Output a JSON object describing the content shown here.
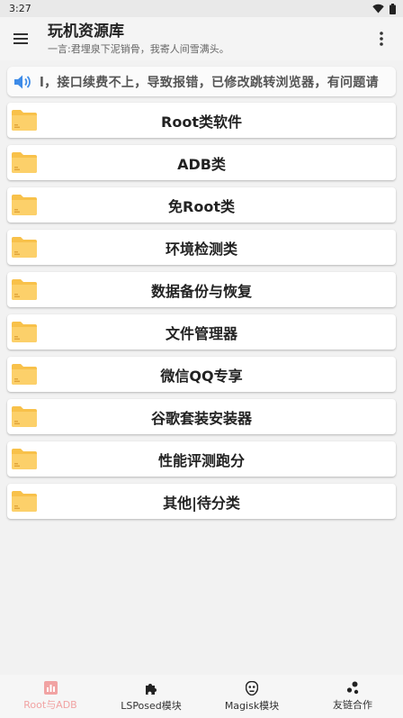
{
  "status_bar": {
    "time": "3:27"
  },
  "app_bar": {
    "title": "玩机资源库",
    "subtitle": "一言:君埋泉下泥销骨，我寄人间雪满头。"
  },
  "notice": {
    "text": "l，接口续费不上，导致报错，已修改跳转浏览器，有问题请"
  },
  "categories": [
    {
      "label": "Root类软件"
    },
    {
      "label": "ADB类"
    },
    {
      "label": "免Root类"
    },
    {
      "label": "环境检测类"
    },
    {
      "label": "数据备份与恢复"
    },
    {
      "label": "文件管理器"
    },
    {
      "label": "微信QQ专享"
    },
    {
      "label": "谷歌套装安装器"
    },
    {
      "label": "性能评测跑分"
    },
    {
      "label": "其他|待分类"
    }
  ],
  "bottom_nav": [
    {
      "label": "Root与ADB",
      "icon": "chart-icon",
      "active": true
    },
    {
      "label": "LSPosed模块",
      "icon": "puzzle-icon",
      "active": false
    },
    {
      "label": "Magisk模块",
      "icon": "mask-icon",
      "active": false
    },
    {
      "label": "友链合作",
      "icon": "share-icon",
      "active": false
    }
  ],
  "colors": {
    "folder": "#f8c14a",
    "active_nav": "#f1a3a3",
    "notice_icon": "#3d8be8"
  }
}
